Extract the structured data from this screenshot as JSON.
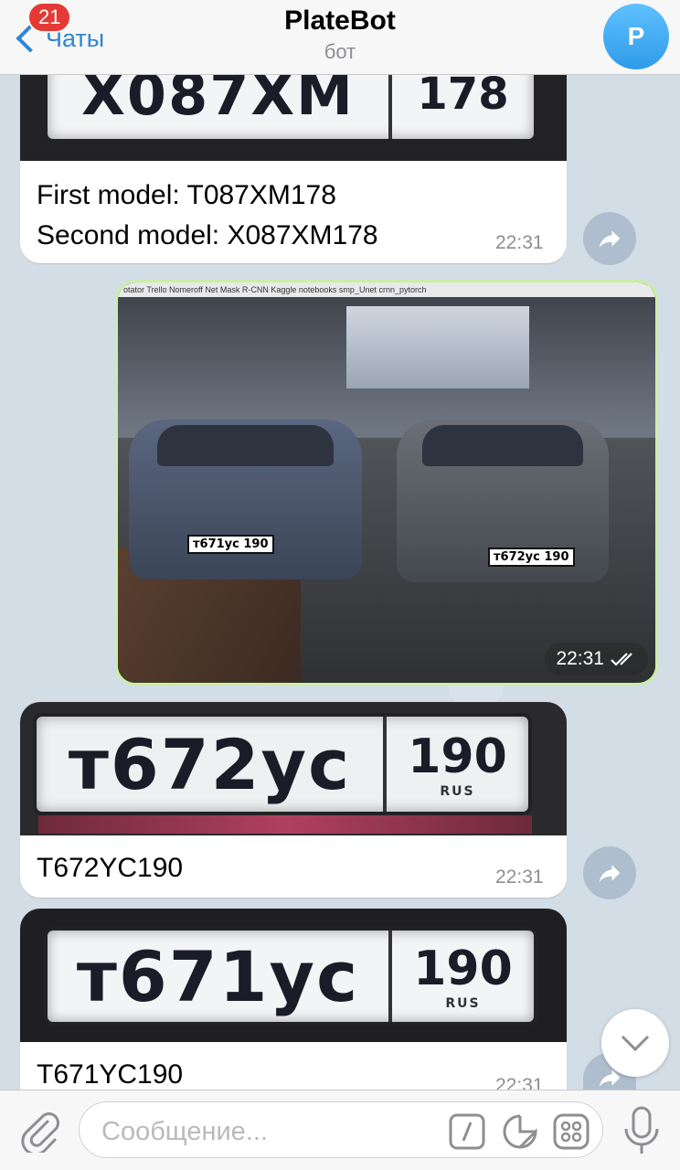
{
  "header": {
    "back_label": "Чаты",
    "unread_count": "21",
    "title": "PlateBot",
    "subtitle": "бот",
    "avatar_letter": "P"
  },
  "messages": {
    "m1": {
      "plate_text": "X087XM",
      "plate_region": "178",
      "line1": "First model: T087XM178",
      "line2": "Second model: X087XM178",
      "time": "22:31"
    },
    "photo": {
      "toolbar": "otator  Trello  Nomeroff Net  Mask R-CNN  Kaggle  notebooks  smp_Unet  crnn_pytorch",
      "plate_a": "т671ус 190",
      "plate_b": "т672ус 190",
      "time": "22:31"
    },
    "m3": {
      "plate_text": "т672ус",
      "plate_region": "190",
      "plate_rus": "RUS",
      "caption": "T672YC190",
      "time": "22:31"
    },
    "m4": {
      "plate_text": "т671ус",
      "plate_region": "190",
      "plate_rus": "RUS",
      "caption": "T671YC190",
      "time": "22:31"
    }
  },
  "input": {
    "placeholder": "Сообщение..."
  },
  "colors": {
    "accent": "#2f86d4",
    "badge": "#e53935",
    "outgoing_bubble": "#e1fec6",
    "incoming_bubble": "#ffffff"
  },
  "icons": {
    "back": "chevron-left-icon",
    "forward": "share-arrow-icon",
    "attach": "paperclip-icon",
    "commands": "slash-command-icon",
    "stickers": "sticker-icon",
    "bot_keyboard": "keyboard-grid-icon",
    "mic": "microphone-icon",
    "scroll": "chevron-down-icon",
    "read": "double-check-icon"
  }
}
